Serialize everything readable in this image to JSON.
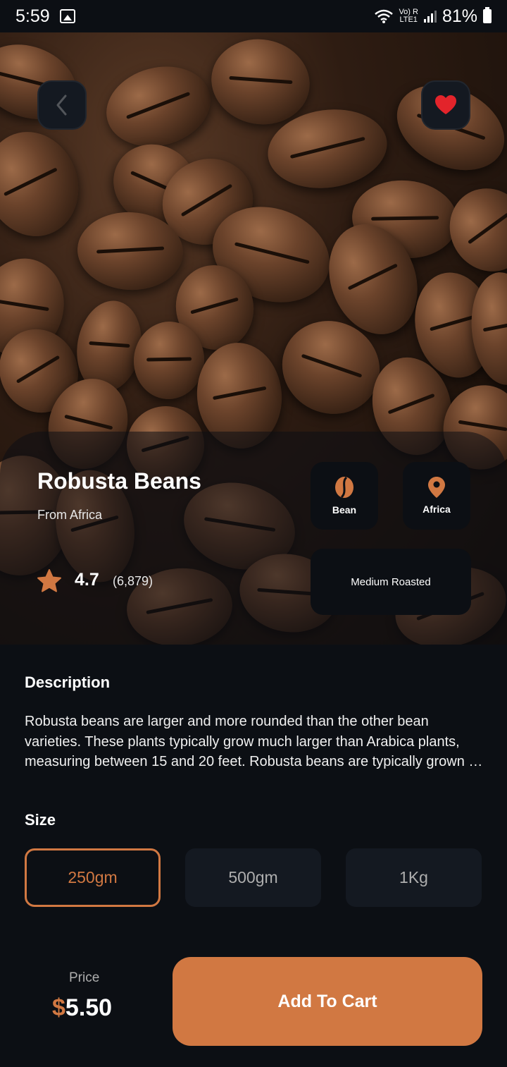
{
  "status_bar": {
    "time": "5:59",
    "network_top": "Vo) R",
    "network_bottom": "LTE1",
    "battery": "81%"
  },
  "product": {
    "name": "Robusta Beans",
    "origin_label": "From Africa",
    "rating": "4.7",
    "rating_count": "(6,879)",
    "is_favorite": true
  },
  "chips": {
    "type_label": "Bean",
    "region_label": "Africa",
    "roast_label": "Medium Roasted"
  },
  "description": {
    "title": "Description",
    "text": "Robusta beans are larger and more rounded than the other bean varieties. These plants typically grow much larger than Arabica plants, measuring between 15 and 20 feet. Robusta beans are typically grown at lower altitudes and have a harsher, more bitter flavor."
  },
  "size": {
    "title": "Size",
    "options": [
      "250gm",
      "500gm",
      "1Kg"
    ],
    "selected": "250gm"
  },
  "price": {
    "label": "Price",
    "currency": "$",
    "amount": "5.50"
  },
  "cart_button_label": "Add To Cart",
  "colors": {
    "accent": "#d17842",
    "background": "#0c0f14",
    "surface": "#141921",
    "favorite": "#e3242b",
    "muted_text": "#aeaeae"
  },
  "icons": {
    "back": "chevron-left-icon",
    "favorite": "heart-icon",
    "rating": "star-icon",
    "bean": "coffee-bean-icon",
    "location": "location-pin-icon"
  }
}
